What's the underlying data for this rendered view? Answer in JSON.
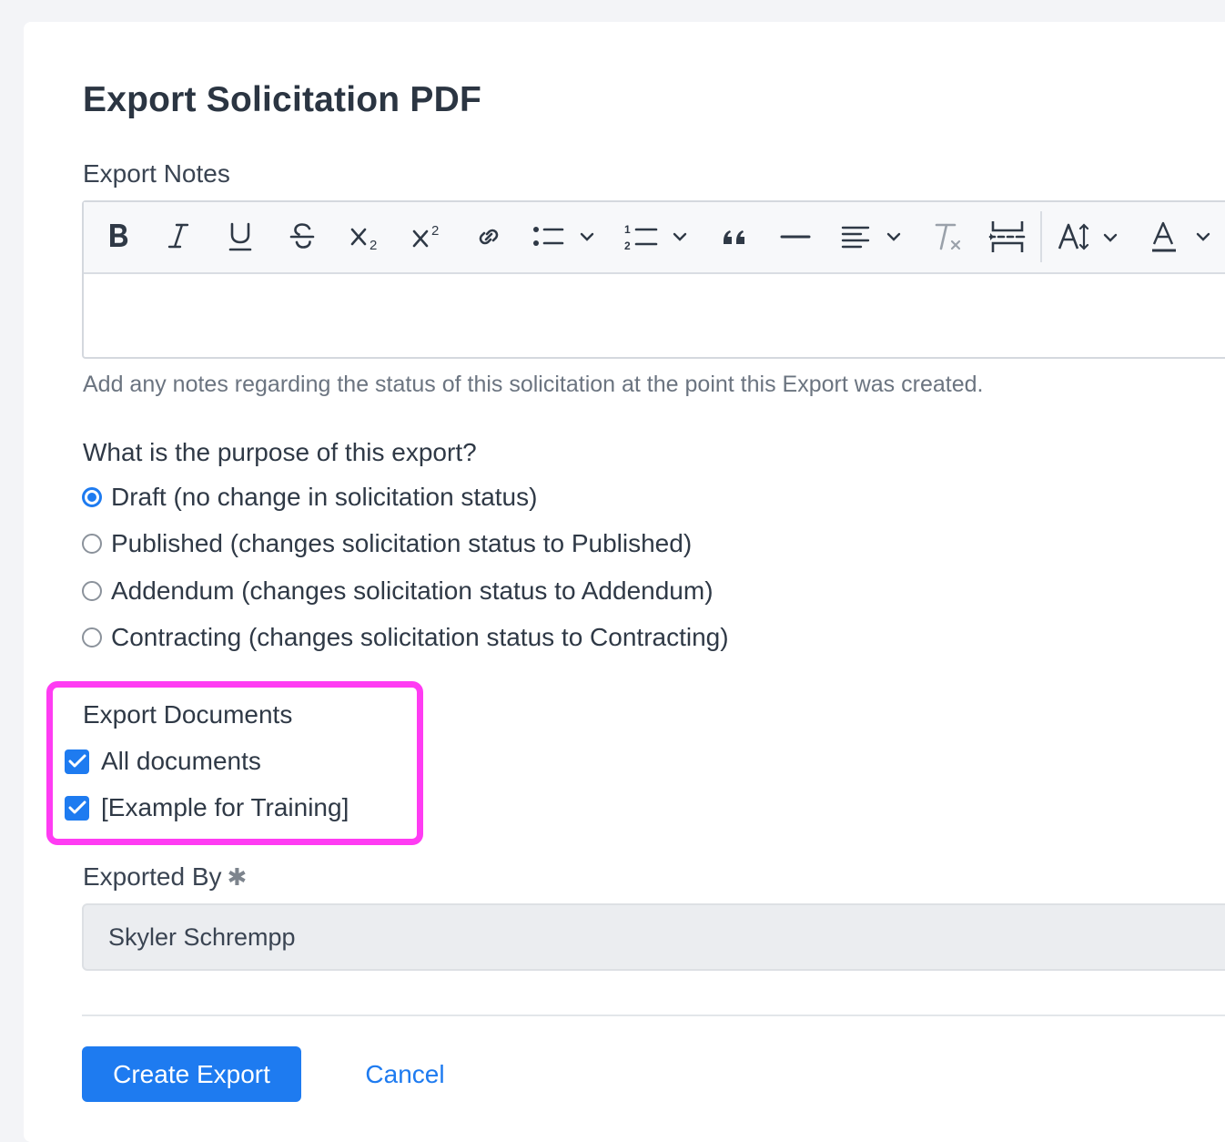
{
  "dialog": {
    "title": "Export Solicitation PDF"
  },
  "export_notes": {
    "label": "Export Notes",
    "value": "",
    "help": "Add any notes regarding the status of this solicitation at the point this Export was created.",
    "toolbar": [
      {
        "name": "bold-icon"
      },
      {
        "name": "italic-icon"
      },
      {
        "name": "underline-icon"
      },
      {
        "name": "strikethrough-icon"
      },
      {
        "name": "subscript-icon"
      },
      {
        "name": "superscript-icon"
      },
      {
        "name": "link-icon"
      },
      {
        "name": "bulleted-list-icon"
      },
      {
        "name": "numbered-list-icon"
      },
      {
        "name": "blockquote-icon"
      },
      {
        "name": "horizontal-rule-icon"
      },
      {
        "name": "align-icon"
      },
      {
        "name": "clear-formatting-icon"
      },
      {
        "name": "page-break-icon"
      },
      {
        "name": "font-size-icon"
      },
      {
        "name": "font-color-icon"
      }
    ]
  },
  "purpose": {
    "label": "What is the purpose of this export?",
    "selected": 0,
    "options": [
      {
        "label": "Draft (no change in solicitation status)"
      },
      {
        "label": "Published (changes solicitation status to Published)"
      },
      {
        "label": "Addendum (changes solicitation status to Addendum)"
      },
      {
        "label": "Contracting (changes solicitation status to Contracting)"
      }
    ]
  },
  "export_documents": {
    "label": "Export Documents",
    "items": [
      {
        "label": "All documents",
        "checked": true
      },
      {
        "label": "[Example for Training]",
        "checked": true
      }
    ],
    "highlight_color": "#ff3cf3"
  },
  "exported_by": {
    "label": "Exported By",
    "required_mark": "✱",
    "value": "Skyler Schrempp"
  },
  "actions": {
    "create_label": "Create Export",
    "cancel_label": "Cancel"
  },
  "colors": {
    "accent": "#1e7bf0",
    "text": "#2f3946",
    "muted": "#6b7480"
  }
}
